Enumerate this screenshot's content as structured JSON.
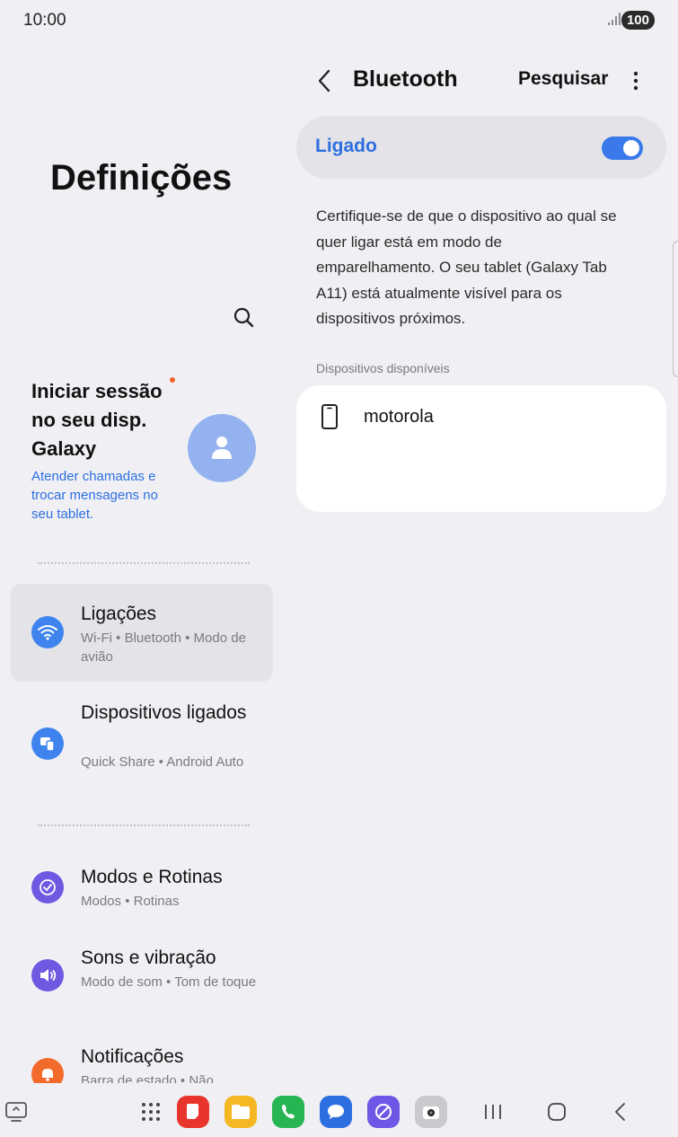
{
  "status_bar": {
    "time": "10:00",
    "battery": "100"
  },
  "left_pane": {
    "title": "Definições",
    "account": {
      "title": "Iniciar sessão no seu disp. Galaxy",
      "subtitle": "Atender chamadas e trocar mensagens no seu tablet."
    },
    "items": [
      {
        "title": "Ligações",
        "subtitle": "Wi-Fi • Bluetooth • Modo de avião",
        "icon": "wifi-icon",
        "color": "#3f84ee"
      },
      {
        "title": "Dispositivos ligados",
        "subtitle": "Quick Share • Android Auto",
        "icon": "connected-devices-icon",
        "color": "#3f84ee"
      },
      {
        "title": "Modos e Rotinas",
        "subtitle": "Modos • Rotinas",
        "icon": "modes-icon",
        "color": "#7158e2"
      },
      {
        "title": "Sons e vibração",
        "subtitle": "Modo de som • Tom de toque",
        "icon": "sound-icon",
        "color": "#7158e2"
      },
      {
        "title": "Notificações",
        "subtitle": "Barra de estado • Não",
        "icon": "bell-icon",
        "color": "#f26b2a"
      }
    ]
  },
  "right_pane": {
    "title": "Bluetooth",
    "search_label": "Pesquisar",
    "toggle_label": "Ligado",
    "toggle_on": true,
    "description": "Certifique-se de que o dispositivo ao qual se quer ligar está em modo de emparelhamento. O seu tablet (Galaxy Tab A11) está atualmente visível para os dispositivos próximos.",
    "section_label": "Dispositivos disponíveis",
    "devices": [
      {
        "name": "motorola",
        "icon": "phone-icon"
      }
    ]
  },
  "nav_bar": {
    "apps": [
      {
        "name": "notes-app-icon",
        "color": "#e8342c"
      },
      {
        "name": "my-files-app-icon",
        "color": "#f5b723"
      },
      {
        "name": "phone-app-icon",
        "color": "#27b452"
      },
      {
        "name": "messages-app-icon",
        "color": "#2d6fe0"
      },
      {
        "name": "internet-app-icon",
        "color": "#6f56e6"
      },
      {
        "name": "camera-app-icon",
        "color": "#c9c9ce"
      }
    ]
  },
  "colors": {
    "accent": "#2d6fe0",
    "background": "#f0f0f4",
    "card": "#ffffff"
  }
}
